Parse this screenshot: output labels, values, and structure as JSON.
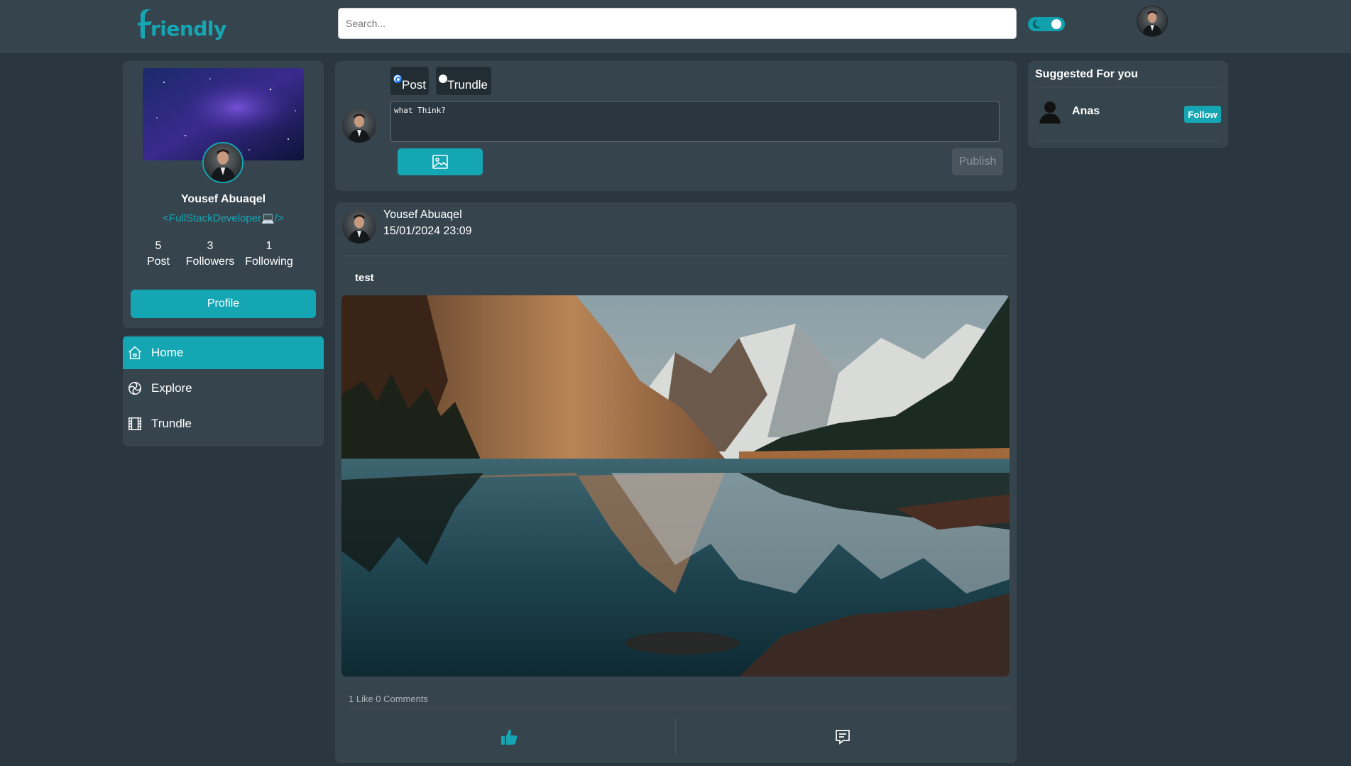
{
  "header": {
    "logo_text": "riendly",
    "search_placeholder": "Search...",
    "theme_toggle": "on"
  },
  "profile": {
    "name": "Yousef Abuaqel",
    "bio": "<FullStackDeveloper💻/>",
    "stats": [
      {
        "value": "5",
        "label": "Post"
      },
      {
        "value": "3",
        "label": "Followers"
      },
      {
        "value": "1",
        "label": "Following"
      }
    ],
    "profile_button": "Profile"
  },
  "nav": {
    "items": [
      {
        "label": "Home",
        "icon": "home-icon",
        "active": true
      },
      {
        "label": "Explore",
        "icon": "explore-icon",
        "active": false
      },
      {
        "label": "Trundle",
        "icon": "film-icon",
        "active": false
      }
    ]
  },
  "composer": {
    "options": [
      {
        "label": "Post",
        "checked": true
      },
      {
        "label": "Trundle",
        "checked": false
      }
    ],
    "placeholder": "what Think?",
    "image_button_icon": "image-icon",
    "publish_label": "Publish"
  },
  "post": {
    "author": "Yousef Abuaqel",
    "date": "15/01/2024 23:09",
    "text": "test",
    "stats": "1 Like 0 Comments",
    "like_icon": "thumbs-up-icon",
    "comment_icon": "comment-icon"
  },
  "suggested": {
    "title": "Suggested For you",
    "users": [
      {
        "name": "Anas",
        "follow_label": "Follow"
      }
    ]
  },
  "colors": {
    "accent": "#14a7b3",
    "background": "#2b3740",
    "panel": "#36444e"
  }
}
